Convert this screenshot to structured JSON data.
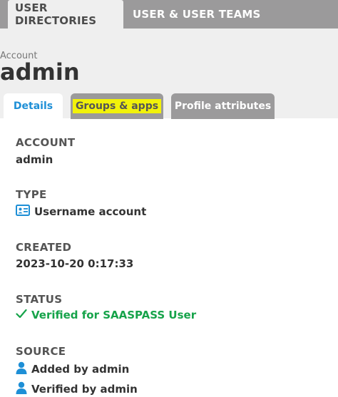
{
  "top_tabs": [
    {
      "label": "USER DIRECTORIES"
    },
    {
      "label": "USER & USER TEAMS"
    }
  ],
  "header": {
    "section_label": "Account",
    "account_name": "admin"
  },
  "tabs": [
    {
      "label": "Details"
    },
    {
      "label": "Groups & apps"
    },
    {
      "label": "Profile attributes"
    }
  ],
  "fields": {
    "account": {
      "label": "ACCOUNT",
      "value": "admin"
    },
    "type": {
      "label": "TYPE",
      "value": "Username account",
      "icon": "id-card-icon"
    },
    "created": {
      "label": "CREATED",
      "value": "2023-10-20 0:17:33"
    },
    "status": {
      "label": "STATUS",
      "value": "Verified for SAASPASS User",
      "icon": "check-icon"
    },
    "source": {
      "label": "SOURCE",
      "values": [
        "Added by admin",
        "Verified by admin"
      ],
      "icon": "user-icon"
    }
  },
  "colors": {
    "accent": "#1e8fd6",
    "success": "#16a34a",
    "highlight": "#f2f20a",
    "tab_bar": "#9b9a9b"
  }
}
